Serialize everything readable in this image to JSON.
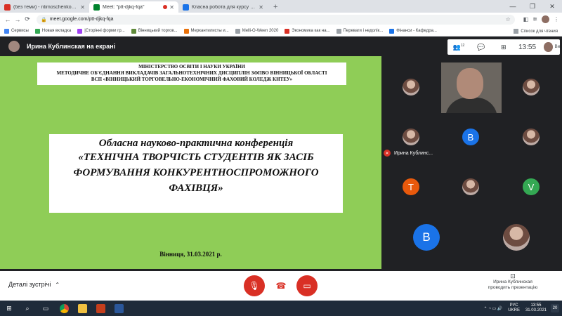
{
  "browser": {
    "tabs": [
      {
        "label": "(без теми) - ntimoschenkom@gm",
        "favicon_color": "#d93025",
        "active": false
      },
      {
        "label": "Meet: \"ptt-djkq-fqa\"",
        "favicon_color": "#00832d",
        "active": true,
        "recording": true
      },
      {
        "label": "Класна робота для курсу \"Бан",
        "favicon_color": "#1a73e8",
        "active": false
      }
    ],
    "new_tab": "+",
    "window_controls": {
      "minimize": "—",
      "maximize": "❐",
      "close": "✕"
    },
    "nav": {
      "back": "←",
      "forward": "→",
      "reload": "⟳"
    },
    "url": "meet.google.com/ptt-djkq-fqa",
    "bookmarks": [
      "Сервисы",
      "Новая вкладка",
      "|Сторінні форми гр...",
      "Вінницький торгов...",
      "Меркантилисты и...",
      "Melli-O-Ween 2020",
      "Экономика как на...",
      "Переваги і недолік...",
      "Фінанси - Кафедра..."
    ],
    "reading_list": "Список для чтения"
  },
  "meet": {
    "presenter_label": "Ирина Кублинская на екрані",
    "participants_count": "12",
    "clock": "13:55",
    "me_label": "Ви",
    "slide": {
      "header_lines": [
        "МІНІСТЕРСТВО ОСВІТИ І НАУКИ УКРАЇНИ",
        "МЕТОДИЧНЕ ОБ'ЄДНАННЯ ВИКЛАДАЧІВ ЗАГАЛЬНОТЕХНІЧНИХ ДИСЦИПЛІН ЗФПВО ВІННИЦЬКОЇ ОБЛАСТІ",
        "ВСП «ВІННИЦЬКИЙ ТОРГОВЕЛЬНО-ЕКОНОМІЧНИЙ ФАХОВИЙ КОЛЕДЖ КНТЕУ»"
      ],
      "title_line1": "Обласна науково-практична конференція",
      "title_line2": "«ТЕХНІЧНА ТВОРЧІСТЬ СТУДЕНТІВ ЯК ЗАСІБ ФОРМУВАННЯ КОНКУРЕНТНОСПРОМОЖНОГО ФАХІВЦЯ»",
      "footer": "Вінниця, 31.03.2021 р.",
      "background_color": "#8fcd57"
    },
    "tiles": {
      "muted_participant": "Ирина Кублинс...",
      "letters": [
        "B",
        "T",
        "V",
        "B"
      ]
    },
    "controls": {
      "details": "Деталі зустрічі",
      "present_line1": "Ирина Кублинская",
      "present_line2": "проводить презентацію"
    }
  },
  "taskbar": {
    "lang_line1": "РУС",
    "lang_line2": "UKRE",
    "time": "13:55",
    "date": "31.03.2021",
    "notifications": "20"
  }
}
